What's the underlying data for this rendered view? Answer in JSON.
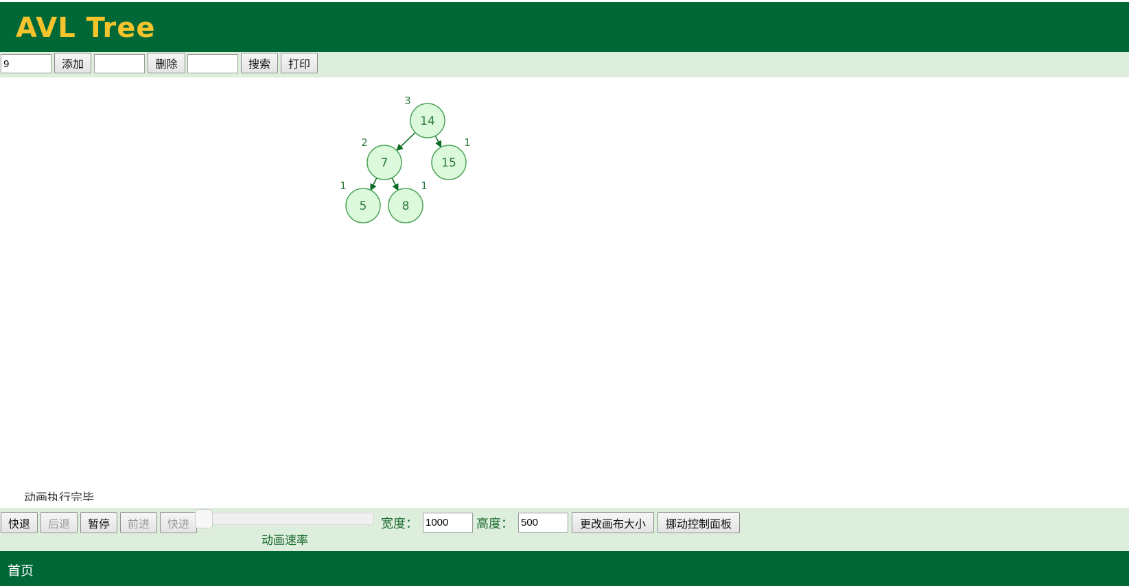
{
  "header": {
    "title": "AVL Tree"
  },
  "toolbar": {
    "add_input_value": "9",
    "add_label": "添加",
    "delete_input_value": "",
    "delete_label": "删除",
    "search_input_value": "",
    "search_label": "搜索",
    "print_label": "打印"
  },
  "tree": {
    "nodes": [
      {
        "key": "14",
        "height": "3"
      },
      {
        "key": "7",
        "height": "2"
      },
      {
        "key": "15",
        "height": "1"
      },
      {
        "key": "5",
        "height": "1"
      },
      {
        "key": "8",
        "height": "1"
      }
    ],
    "edges": [
      [
        "14",
        "7"
      ],
      [
        "14",
        "15"
      ],
      [
        "7",
        "5"
      ],
      [
        "7",
        "8"
      ]
    ],
    "colors": {
      "node_fill": "#dcf9dc",
      "node_stroke": "#4aa356",
      "text": "#2f7a3a",
      "edge": "#0b6b24"
    }
  },
  "status": {
    "text": "动画执行完毕"
  },
  "controls": {
    "skip_back_label": "快退",
    "step_back_label": "后退",
    "pause_label": "暂停",
    "step_forward_label": "前进",
    "skip_forward_label": "快进",
    "speed_label": "动画速率",
    "width_label": "宽度：",
    "width_value": "1000",
    "height_label": "高度：",
    "height_value": "500",
    "resize_label": "更改画布大小",
    "move_panel_label": "挪动控制面板"
  },
  "footer": {
    "home_label": "首页"
  },
  "theme": {
    "dark_green": "#006837",
    "light_green": "#deeedd",
    "title_yellow": "#f5c32c"
  }
}
